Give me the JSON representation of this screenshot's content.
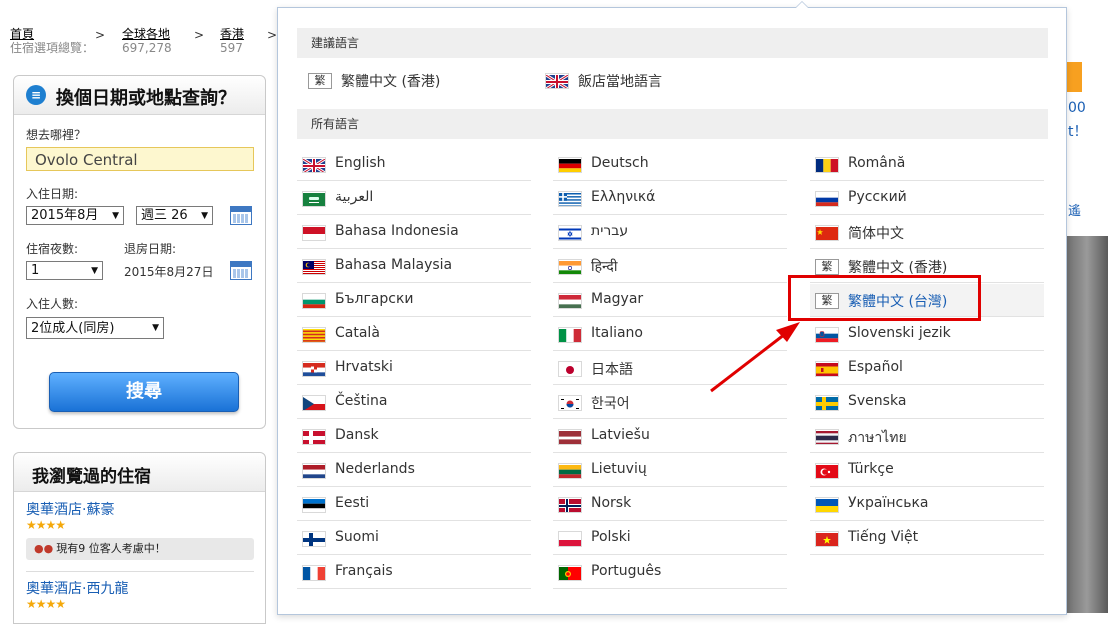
{
  "breadcrumb": {
    "items": [
      {
        "label": "首頁",
        "sub": "住宿選項總覽："
      },
      {
        "label": "全球各地",
        "sub": "697,278"
      },
      {
        "label": "香港",
        "sub": "597"
      }
    ],
    "separator": ">"
  },
  "search": {
    "title": "換個日期或地點查詢？",
    "title_icon": "document-icon",
    "dest_label": "想去哪裡？",
    "dest_value": "Ovolo Central",
    "checkin_label": "入住日期:",
    "checkin_month": "2015年8月",
    "checkin_day": "週三 26",
    "nights_label": "住宿夜數:",
    "nights_value": "1",
    "checkout_label": "退房日期:",
    "checkout_value": "2015年8月27日",
    "guests_label": "入住人數:",
    "guests_value": "2位成人(同房)",
    "button": "搜尋"
  },
  "recent": {
    "title": "我瀏覽過的住宿",
    "hotels": [
      {
        "name": "奧華酒店·蘇豪",
        "stars": "★★★★",
        "viewing": "現有9 位客人考慮中！"
      },
      {
        "name": "奧華酒店·西九龍",
        "stars": "★★★★"
      }
    ]
  },
  "background": {
    "t1": "00",
    "t2": "t！",
    "t3": "遙"
  },
  "languages": {
    "suggested_header": "建議語言",
    "all_header": "所有語言",
    "suggested": [
      {
        "label": "繁體中文 (香港)",
        "flag": "trad",
        "glyph": "繁"
      },
      {
        "label": "飯店當地語言",
        "flag": "uk"
      }
    ],
    "columns": [
      [
        {
          "label": "English",
          "flag": "uk"
        },
        {
          "label": "العربية",
          "flag": "sa"
        },
        {
          "label": "Bahasa Indonesia",
          "flag": "id"
        },
        {
          "label": "Bahasa Malaysia",
          "flag": "my"
        },
        {
          "label": "Български",
          "flag": "bg"
        },
        {
          "label": "Català",
          "flag": "cat"
        },
        {
          "label": "Hrvatski",
          "flag": "hr"
        },
        {
          "label": "Čeština",
          "flag": "cz"
        },
        {
          "label": "Dansk",
          "flag": "dk"
        },
        {
          "label": "Nederlands",
          "flag": "nl"
        },
        {
          "label": "Eesti",
          "flag": "ee"
        },
        {
          "label": "Suomi",
          "flag": "fi"
        },
        {
          "label": "Français",
          "flag": "fr"
        }
      ],
      [
        {
          "label": "Deutsch",
          "flag": "de"
        },
        {
          "label": "Ελληνικά",
          "flag": "gr"
        },
        {
          "label": "עברית",
          "flag": "il"
        },
        {
          "label": "हिन्दी",
          "flag": "in"
        },
        {
          "label": "Magyar",
          "flag": "hu"
        },
        {
          "label": "Italiano",
          "flag": "it"
        },
        {
          "label": "日本語",
          "flag": "jp"
        },
        {
          "label": "한국어",
          "flag": "kr"
        },
        {
          "label": "Latviešu",
          "flag": "lv"
        },
        {
          "label": "Lietuvių",
          "flag": "lt"
        },
        {
          "label": "Norsk",
          "flag": "no"
        },
        {
          "label": "Polski",
          "flag": "pl"
        },
        {
          "label": "Português",
          "flag": "pt"
        }
      ],
      [
        {
          "label": "Română",
          "flag": "ro"
        },
        {
          "label": "Русский",
          "flag": "ru"
        },
        {
          "label": "简体中文",
          "flag": "cn"
        },
        {
          "label": "繁體中文 (香港)",
          "flag": "trad",
          "glyph": "繁"
        },
        {
          "label": "繁體中文 (台灣)",
          "flag": "trad",
          "glyph": "繁",
          "highlighted": true
        },
        {
          "label": "Slovenski jezik",
          "flag": "si"
        },
        {
          "label": "Español",
          "flag": "es"
        },
        {
          "label": "Svenska",
          "flag": "se"
        },
        {
          "label": "ภาษาไทย",
          "flag": "th"
        },
        {
          "label": "Türkçe",
          "flag": "tr"
        },
        {
          "label": "Українська",
          "flag": "ua"
        },
        {
          "label": "Tiếng Việt",
          "flag": "vn"
        }
      ]
    ]
  },
  "annotation": {
    "color": "#e00000"
  }
}
